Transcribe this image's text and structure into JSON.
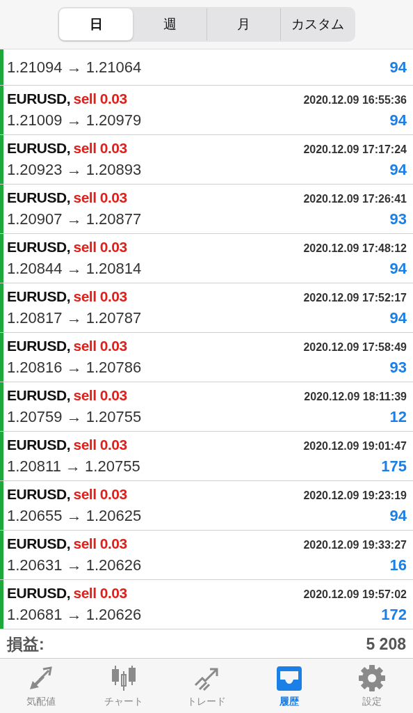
{
  "period_tabs": [
    {
      "label": "日",
      "selected": true
    },
    {
      "label": "週",
      "selected": false
    },
    {
      "label": "月",
      "selected": false
    },
    {
      "label": "カスタム",
      "selected": false
    }
  ],
  "trades": [
    {
      "prices": "1.21094 → 1.21064",
      "profit": "94"
    },
    {
      "symbol": "EURUSD,",
      "type": "sell 0.03",
      "kind": "sell",
      "time": "2020.12.09 16:55:36",
      "prices": "1.21009 → 1.20979",
      "profit": "94"
    },
    {
      "symbol": "EURUSD,",
      "type": "sell 0.03",
      "kind": "sell",
      "time": "2020.12.09 17:17:24",
      "prices": "1.20923 → 1.20893",
      "profit": "94"
    },
    {
      "symbol": "EURUSD,",
      "type": "sell 0.03",
      "kind": "sell",
      "time": "2020.12.09 17:26:41",
      "prices": "1.20907 → 1.20877",
      "profit": "93"
    },
    {
      "symbol": "EURUSD,",
      "type": "sell 0.03",
      "kind": "sell",
      "time": "2020.12.09 17:48:12",
      "prices": "1.20844 → 1.20814",
      "profit": "94"
    },
    {
      "symbol": "EURUSD,",
      "type": "sell 0.03",
      "kind": "sell",
      "time": "2020.12.09 17:52:17",
      "prices": "1.20817 → 1.20787",
      "profit": "94"
    },
    {
      "symbol": "EURUSD,",
      "type": "sell 0.03",
      "kind": "sell",
      "time": "2020.12.09 17:58:49",
      "prices": "1.20816 → 1.20786",
      "profit": "93"
    },
    {
      "symbol": "EURUSD,",
      "type": "sell 0.03",
      "kind": "sell",
      "time": "2020.12.09 18:11:39",
      "prices": "1.20759 → 1.20755",
      "profit": "12"
    },
    {
      "symbol": "EURUSD,",
      "type": "sell 0.03",
      "kind": "sell",
      "time": "2020.12.09 19:01:47",
      "prices": "1.20811 → 1.20755",
      "profit": "175"
    },
    {
      "symbol": "EURUSD,",
      "type": "sell 0.03",
      "kind": "sell",
      "time": "2020.12.09 19:23:19",
      "prices": "1.20655 → 1.20625",
      "profit": "94"
    },
    {
      "symbol": "EURUSD,",
      "type": "sell 0.03",
      "kind": "sell",
      "time": "2020.12.09 19:33:27",
      "prices": "1.20631 → 1.20626",
      "profit": "16"
    },
    {
      "symbol": "EURUSD,",
      "type": "sell 0.03",
      "kind": "sell",
      "time": "2020.12.09 19:57:02",
      "prices": "1.20681 → 1.20626",
      "profit": "172"
    }
  ],
  "total": {
    "label": "損益:",
    "value": "5 208"
  },
  "nav": [
    {
      "label": "気配値",
      "kind": "quotes",
      "selected": false
    },
    {
      "label": "チャート",
      "kind": "chart",
      "selected": false
    },
    {
      "label": "トレード",
      "kind": "trade",
      "selected": false
    },
    {
      "label": "履歴",
      "kind": "history",
      "selected": true
    },
    {
      "label": "設定",
      "kind": "settings",
      "selected": false
    }
  ]
}
